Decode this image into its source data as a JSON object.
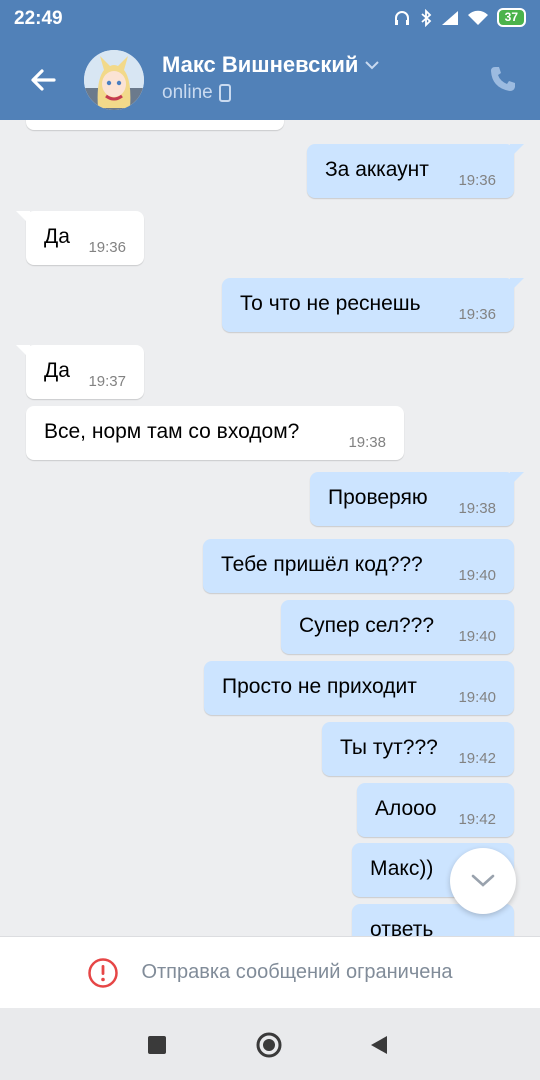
{
  "status_bar": {
    "time": "22:49",
    "battery": "37",
    "icons": [
      "headphones-icon",
      "bluetooth-icon",
      "signal-icon",
      "wifi-icon",
      "battery-icon"
    ]
  },
  "header": {
    "name": "Макс Вишневский",
    "status": "online"
  },
  "messages": [
    {
      "dir": "out",
      "text": "За аккаунт",
      "time": "19:36"
    },
    {
      "dir": "in",
      "text": "Да",
      "time": "19:36"
    },
    {
      "dir": "out",
      "text": "То что не реснешь",
      "time": "19:36"
    },
    {
      "dir": "in",
      "text": "Да",
      "time": "19:37"
    },
    {
      "dir": "in",
      "text": "Все, норм там со входом?",
      "time": "19:38"
    },
    {
      "dir": "out",
      "text": "Проверяю",
      "time": "19:38"
    },
    {
      "dir": "out",
      "text": "Тебе пришёл код???",
      "time": "19:40"
    },
    {
      "dir": "out",
      "text": "Супер сел???",
      "time": "19:40"
    },
    {
      "dir": "out",
      "text": "Просто не приходит",
      "time": "19:40"
    },
    {
      "dir": "out",
      "text": "Ты тут???",
      "time": "19:42"
    },
    {
      "dir": "out",
      "text": "Алооо",
      "time": "19:42"
    },
    {
      "dir": "out",
      "text": "Макс))",
      "time": ""
    },
    {
      "dir": "out",
      "text": "ответь",
      "time": ""
    }
  ],
  "restricted_notice": "Отправка сообщений ограничена",
  "colors": {
    "header": "#5181b8",
    "outgoing_bubble": "#cce4ff",
    "incoming_bubble": "#ffffff",
    "background": "#edeef0",
    "alert": "#e64646"
  }
}
